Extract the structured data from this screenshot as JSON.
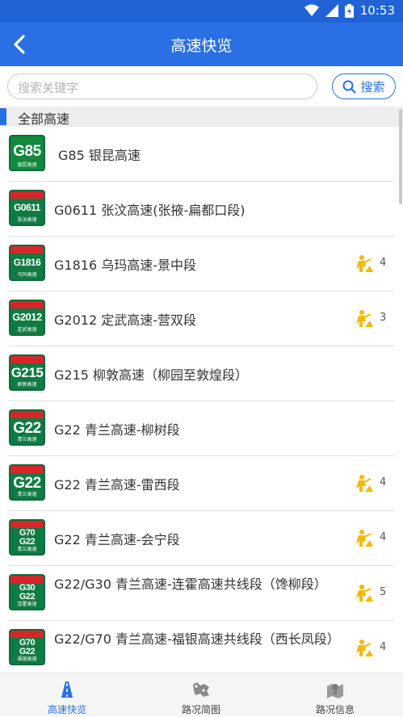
{
  "status": {
    "time": "10:53"
  },
  "header": {
    "title": "高速快览"
  },
  "search": {
    "placeholder": "搜索关键字",
    "button_label": "搜索"
  },
  "section": {
    "label": "全部高速"
  },
  "highways": [
    {
      "shield": "G85",
      "shield_sub": "银昆高速",
      "name": "G85 银昆高速",
      "works": ""
    },
    {
      "shield": "G0611",
      "shield_sub": "张汶高速",
      "name": "G0611 张汶高速(张掖-扁都口段)",
      "works": ""
    },
    {
      "shield": "G1816",
      "shield_sub": "乌玛高速",
      "name": "G1816 乌玛高速-景中段",
      "works": "4"
    },
    {
      "shield": "G2012",
      "shield_sub": "定武高速",
      "name": "G2012 定武高速-营双段",
      "works": "3"
    },
    {
      "shield": "G215",
      "shield_sub": "柳敦高速",
      "name": "G215 柳敦高速（柳园至敦煌段）",
      "works": ""
    },
    {
      "shield": "G22",
      "shield_sub": "青兰高速",
      "name": "G22 青兰高速-柳树段",
      "works": ""
    },
    {
      "shield": "G22",
      "shield_sub": "青兰高速",
      "name": "G22 青兰高速-雷西段",
      "works": "4"
    },
    {
      "shield": "G70 G22",
      "shield_sub": "青兰高速",
      "name": "G22 青兰高速-会宁段",
      "works": "4"
    },
    {
      "shield": "G30 G22",
      "shield_sub": "连霍高速",
      "name": "G22/G30 青兰高速-连霍高速共线段（馋柳段）",
      "works": "5"
    },
    {
      "shield": "G70 G22",
      "shield_sub": "福银高速",
      "name": "G22/G70 青兰高速-福银高速共线段（西长凤段）",
      "works": "4"
    }
  ],
  "tabs": [
    {
      "label": "高速快览",
      "icon": "highway-icon",
      "active": true
    },
    {
      "label": "路况简图",
      "icon": "route-map-icon",
      "active": false
    },
    {
      "label": "路况信息",
      "icon": "traffic-info-icon",
      "active": false
    }
  ],
  "colors": {
    "primary": "#2a6fe3",
    "shield_green": "#107a43",
    "shield_red": "#d7262a",
    "work_yellow": "#f5b800"
  }
}
